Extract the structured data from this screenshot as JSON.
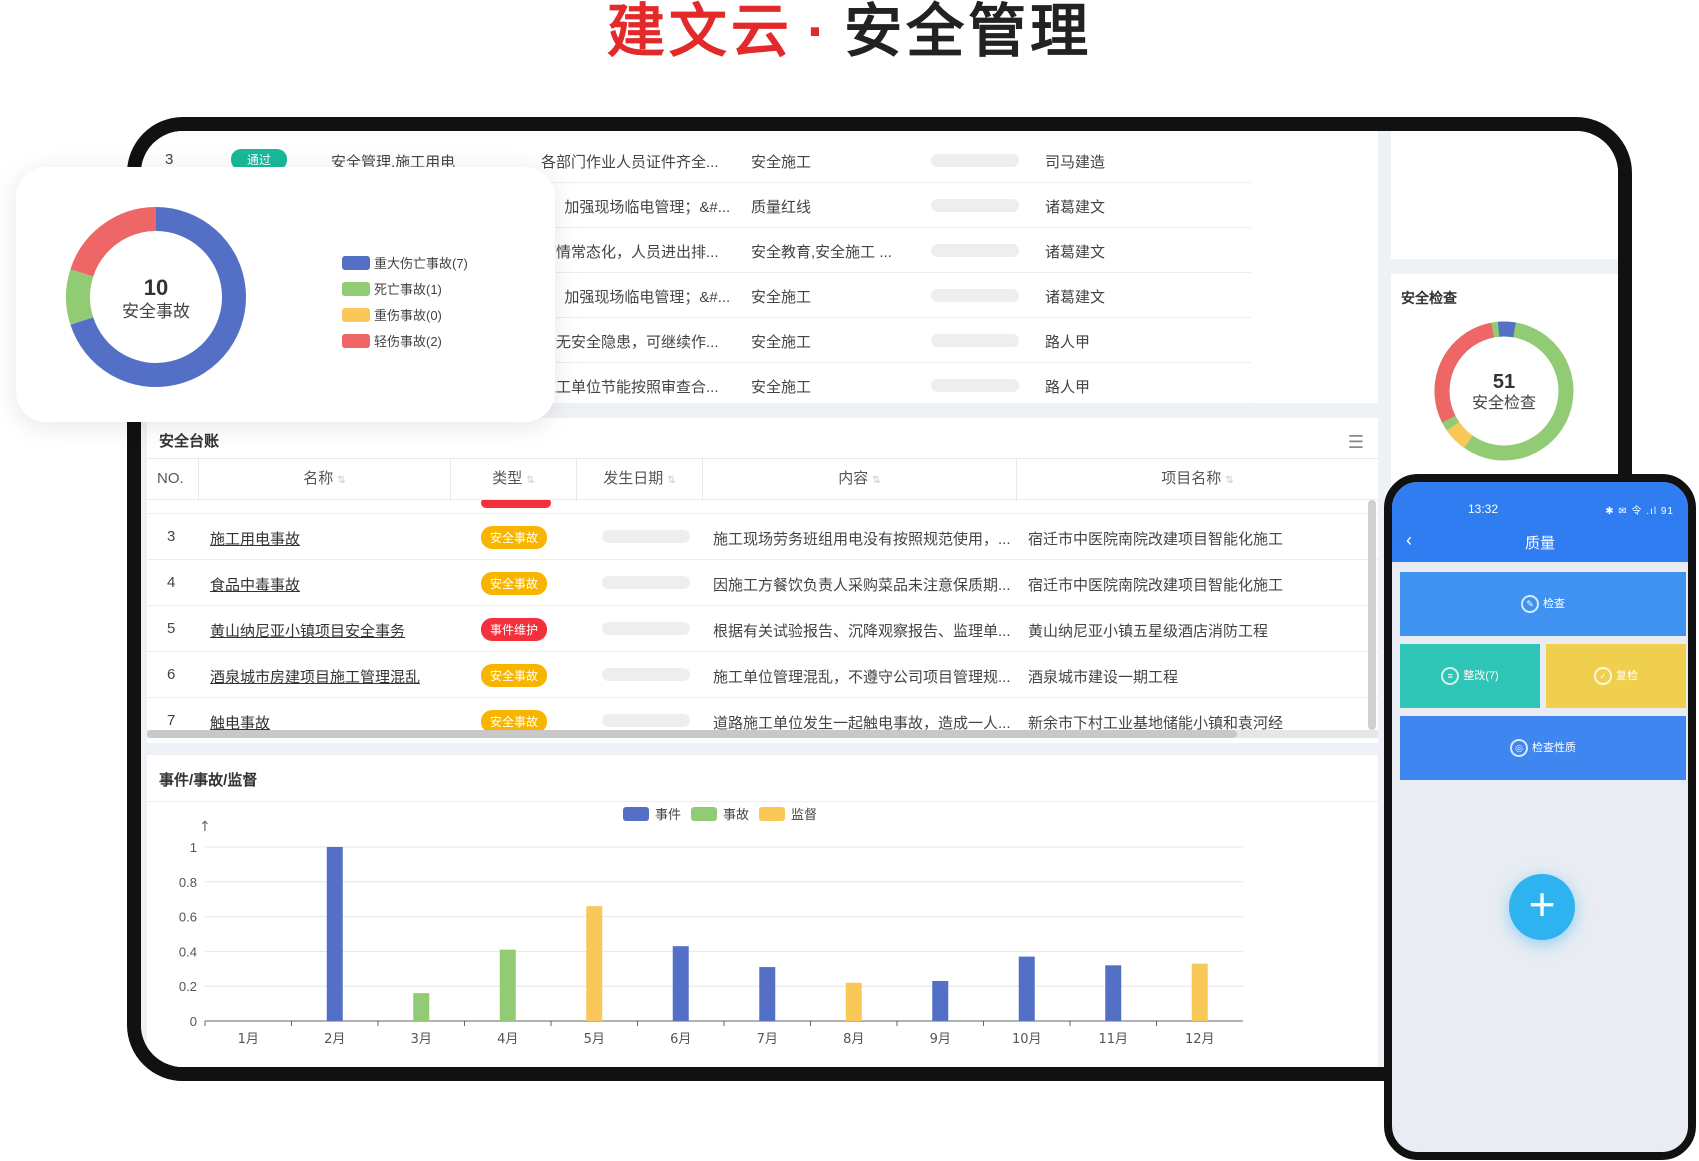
{
  "brand": {
    "part1": "建文云",
    "dot": "·",
    "part2": "安全管理"
  },
  "top_list": {
    "rows": [
      {
        "no": "3",
        "status": "通过",
        "type": "安全管理,施工用电",
        "content": "各部门作业人员证件齐全...",
        "category": "安全施工",
        "owner": "司马建造"
      },
      {
        "no": "",
        "status": "",
        "type": "",
        "content": "1、加强现场临电管理；&#...",
        "category": "质量红线",
        "owner": "诸葛建文"
      },
      {
        "no": "",
        "status": "",
        "type": "",
        "content": "疫情常态化，人员进出排...",
        "category": "安全教育,安全施工 ...",
        "owner": "诸葛建文"
      },
      {
        "no": "",
        "status": "",
        "type": "",
        "content": "1、加强现场临电管理；&#...",
        "category": "安全施工",
        "owner": "诸葛建文"
      },
      {
        "no": "",
        "status": "",
        "type": "",
        "content": "暂无安全隐患，可继续作...",
        "category": "安全施工",
        "owner": "路人甲"
      },
      {
        "no": "",
        "status": "",
        "type": "",
        "content": "施工单位节能按照审查合...",
        "category": "安全施工",
        "owner": "路人甲"
      }
    ]
  },
  "accident_popup": {
    "total": "10",
    "label": "安全事故",
    "legend": [
      {
        "label": "重大伤亡事故(7)",
        "color": "#5470c6"
      },
      {
        "label": "死亡事故(1)",
        "color": "#91cc75"
      },
      {
        "label": "重伤事故(0)",
        "color": "#fac858"
      },
      {
        "label": "轻伤事故(2)",
        "color": "#ee6666"
      }
    ],
    "chart_data": {
      "type": "pie",
      "categories": [
        "重大伤亡事故",
        "死亡事故",
        "重伤事故",
        "轻伤事故"
      ],
      "values": [
        7,
        1,
        0,
        2
      ]
    }
  },
  "safety_check": {
    "title": "安全检查",
    "total": "51",
    "label": "安全检查"
  },
  "ledger": {
    "title": "安全台账",
    "menu_icon": "menu-icon",
    "columns": [
      "NO.",
      "名称",
      "类型",
      "发生日期",
      "内容",
      "项目名称"
    ],
    "rows": [
      {
        "no": "3",
        "name": "施工用电事故",
        "type": "安全事故",
        "type_color": "#f7b500",
        "content": "施工现场劳务班组用电没有按照规范使用，...",
        "project": "宿迁市中医院南院改建项目智能化施工"
      },
      {
        "no": "4",
        "name": "食品中毒事故",
        "type": "安全事故",
        "type_color": "#f7b500",
        "content": "因施工方餐饮负责人采购菜品未注意保质期...",
        "project": "宿迁市中医院南院改建项目智能化施工"
      },
      {
        "no": "5",
        "name": "黄山纳尼亚小镇项目安全事务",
        "type": "事件维护",
        "type_color": "#f5303e",
        "content": "根据有关试验报告、沉降观察报告、监理单...",
        "project": "黄山纳尼亚小镇五星级酒店消防工程"
      },
      {
        "no": "6",
        "name": "酒泉城市房建项目施工管理混乱",
        "type": "安全事故",
        "type_color": "#f7b500",
        "content": "施工单位管理混乱，不遵守公司项目管理规...",
        "project": "酒泉城市建设一期工程"
      },
      {
        "no": "7",
        "name": "触电事故",
        "type": "安全事故",
        "type_color": "#f7b500",
        "content": "道路施工单位发生一起触电事故，造成一人...",
        "project": "新余市下村工业基地储能小镇和袁河经"
      }
    ]
  },
  "events_chart": {
    "title": "事件/事故/监督",
    "chart_data": {
      "type": "bar",
      "categories": [
        "1月",
        "2月",
        "3月",
        "4月",
        "5月",
        "6月",
        "7月",
        "8月",
        "9月",
        "10月",
        "11月",
        "12月"
      ],
      "series": [
        {
          "name": "事件",
          "color": "#5470c6",
          "values": [
            0,
            1,
            0,
            0,
            0,
            0.43,
            0.31,
            0,
            0.23,
            0.37,
            0.32,
            0
          ]
        },
        {
          "name": "事故",
          "color": "#91cc75",
          "values": [
            0,
            0,
            0.16,
            0.41,
            0,
            0,
            0,
            0,
            0,
            0,
            0,
            0
          ]
        },
        {
          "name": "监督",
          "color": "#fac858",
          "values": [
            0,
            0,
            0,
            0,
            0.66,
            0,
            0,
            0.22,
            0,
            0,
            0,
            0.33
          ]
        }
      ],
      "yticks": [
        "0",
        "0.2",
        "0.4",
        "0.6",
        "0.8",
        "1"
      ],
      "ylim": [
        0,
        1
      ]
    }
  },
  "phone": {
    "time": "13:32",
    "status_icons": "✱ ✉ 令 .ıl 91",
    "back_icon": "chevron-left-icon",
    "title": "质量",
    "tiles": [
      {
        "label": "检查",
        "color": "#3f92f0"
      },
      {
        "label": "整改(7)",
        "color": "#2ec4b6"
      },
      {
        "label": "复检",
        "color": "#f0cf4e"
      },
      {
        "label": "检查性质",
        "color": "#3f86f0"
      }
    ],
    "fab": "+"
  }
}
